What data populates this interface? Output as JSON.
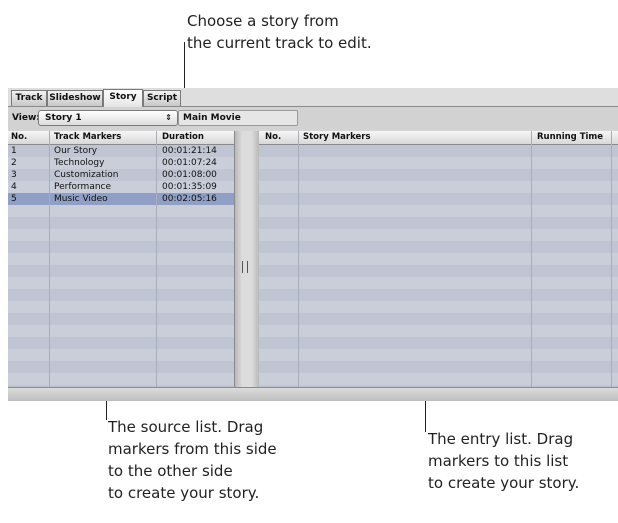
{
  "callouts": {
    "top": [
      "Choose a story from",
      "the current track to edit."
    ],
    "source": [
      "The source list. Drag",
      "markers from this side",
      "to the other side",
      "to create your story."
    ],
    "entry": [
      "The entry list. Drag",
      "markers to this list",
      "to create your story."
    ]
  },
  "tabs": [
    {
      "label": "Track",
      "active": false
    },
    {
      "label": "Slideshow",
      "active": false
    },
    {
      "label": "Story",
      "active": true
    },
    {
      "label": "Script",
      "active": false
    }
  ],
  "view": {
    "label": "View:",
    "selected_story": "Story 1",
    "arrows_glyph": "⇕",
    "movie": "Main Movie"
  },
  "track_markers": {
    "headers": [
      "No.",
      "Track Markers",
      "Duration"
    ],
    "rows": [
      {
        "no": "1",
        "name": "Our Story",
        "duration": "00:01:21:14"
      },
      {
        "no": "2",
        "name": "Technology",
        "duration": "00:01:07:24"
      },
      {
        "no": "3",
        "name": "Customization",
        "duration": "00:01:08:00"
      },
      {
        "no": "4",
        "name": "Performance",
        "duration": "00:01:35:09"
      },
      {
        "no": "5",
        "name": "Music Video",
        "duration": "00:02:05:16",
        "selected": true
      }
    ]
  },
  "story_markers": {
    "headers": [
      "No.",
      "Story Markers",
      "Running Time"
    ],
    "rows": []
  },
  "colors": {
    "row_odd": "#bfc5d3",
    "row_even": "#c9ced9",
    "row_selected": "#8f9fc6"
  }
}
